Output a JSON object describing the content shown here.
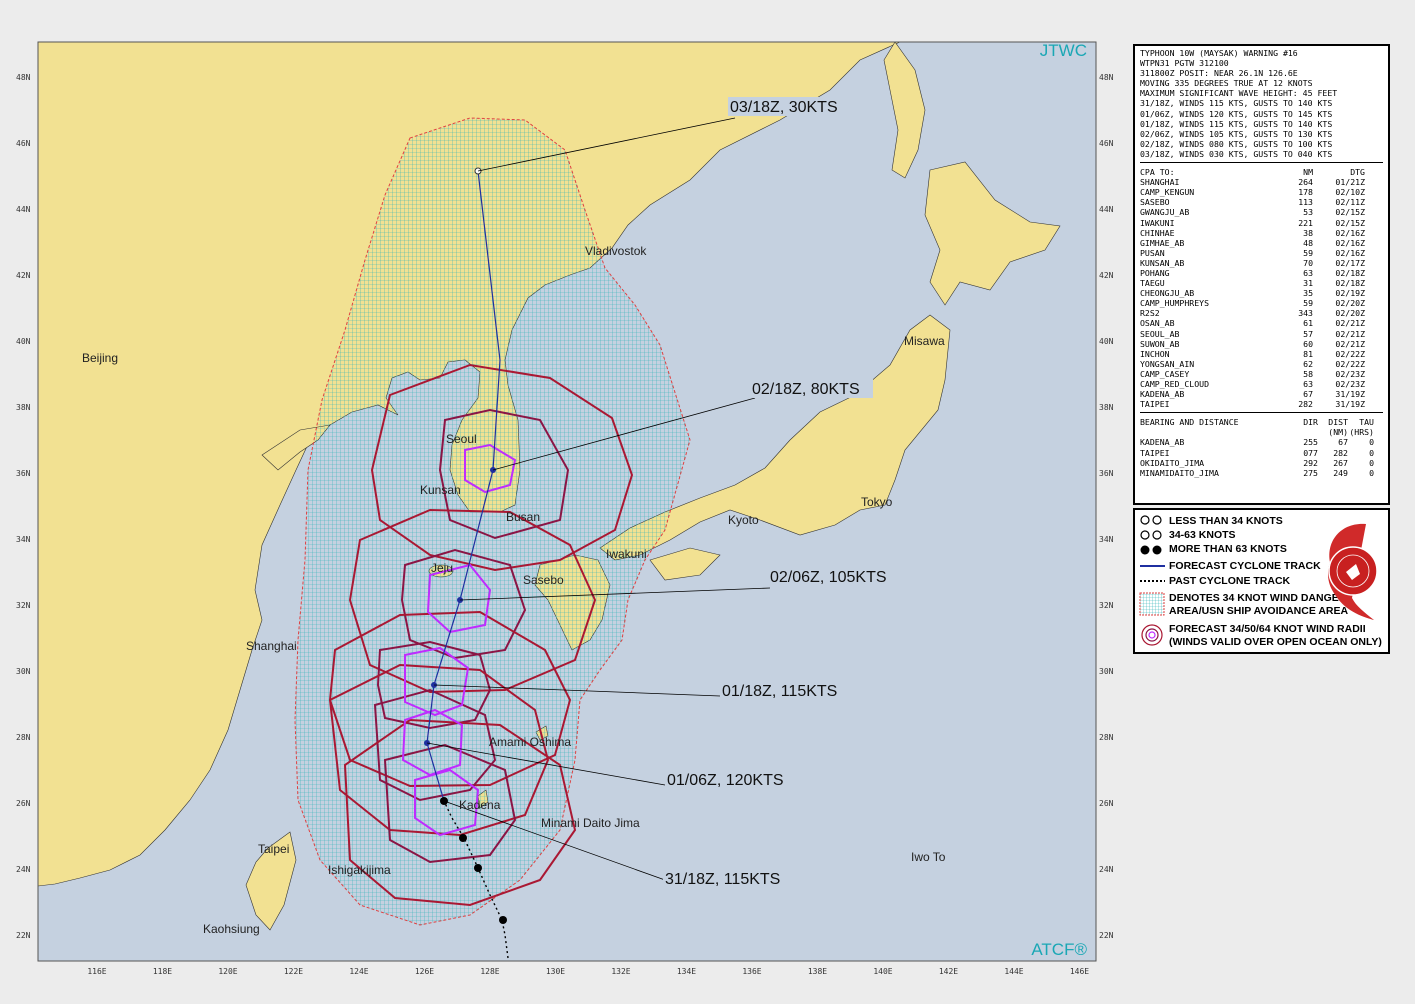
{
  "map": {
    "source_label": "JTWC",
    "footer_label": "ATCF®",
    "lon_labels": [
      "116E",
      "118E",
      "120E",
      "122E",
      "124E",
      "126E",
      "128E",
      "130E",
      "132E",
      "134E",
      "136E",
      "138E",
      "140E",
      "142E",
      "144E",
      "146E"
    ],
    "lat_labels": [
      "48N",
      "46N",
      "44N",
      "42N",
      "40N",
      "38N",
      "36N",
      "34N",
      "32N",
      "30N",
      "28N",
      "26N",
      "24N",
      "22N"
    ],
    "places": [
      "Vladivostok",
      "Beijing",
      "Misawa",
      "Seoul",
      "Kunsan",
      "Busan",
      "Kyoto",
      "Tokyo",
      "Iwakuni",
      "Jeju",
      "Sasebo",
      "Shanghai",
      "Amami Oshima",
      "Kadena",
      "Minami Daito Jima",
      "Taipei",
      "Iwo To",
      "Ishigakijima",
      "Kaohsiung"
    ],
    "forecast_labels": [
      "03/18Z,  30KTS",
      "02/18Z,  80KTS",
      "02/06Z, 105KTS",
      "01/18Z, 115KTS",
      "01/06Z, 120KTS",
      "31/18Z, 115KTS"
    ],
    "colors": {
      "land": "#f2e192",
      "ocean": "#c5d1e0",
      "danger": "#2fb3b8",
      "r34": "#aa1833",
      "r50": "#8b1545",
      "r64": "#bf2cff",
      "track": "#1f2fa0",
      "jtwc": "#1aa7b5"
    }
  },
  "warning": {
    "header": [
      "TYPHOON 10W (MAYSAK) WARNING #16",
      "WTPN31 PGTW 312100",
      "311800Z POSIT: NEAR 26.1N 126.6E",
      "MOVING 335 DEGREES TRUE AT 12 KNOTS",
      "MAXIMUM SIGNIFICANT WAVE HEIGHT: 45 FEET",
      "31/18Z, WINDS 115 KTS, GUSTS TO 140 KTS",
      "01/06Z, WINDS 120 KTS, GUSTS TO 145 KTS",
      "01/18Z, WINDS 115 KTS, GUSTS TO 140 KTS",
      "02/06Z, WINDS 105 KTS, GUSTS TO 130 KTS",
      "02/18Z, WINDS 080 KTS, GUSTS TO 100 KTS",
      "03/18Z, WINDS 030 KTS, GUSTS TO 040 KTS"
    ],
    "cpa_header": [
      "CPA TO:",
      "NM",
      "DTG"
    ],
    "cpa": [
      [
        "SHANGHAI",
        "264",
        "01/21Z"
      ],
      [
        "CAMP_KENGUN",
        "178",
        "02/10Z"
      ],
      [
        "SASEBO",
        "113",
        "02/11Z"
      ],
      [
        "GWANGJU_AB",
        "53",
        "02/15Z"
      ],
      [
        "IWAKUNI",
        "221",
        "02/15Z"
      ],
      [
        "CHINHAE",
        "38",
        "02/16Z"
      ],
      [
        "GIMHAE_AB",
        "48",
        "02/16Z"
      ],
      [
        "PUSAN",
        "59",
        "02/16Z"
      ],
      [
        "KUNSAN_AB",
        "70",
        "02/17Z"
      ],
      [
        "POHANG",
        "63",
        "02/18Z"
      ],
      [
        "TAEGU",
        "31",
        "02/18Z"
      ],
      [
        "CHEONGJU_AB",
        "35",
        "02/19Z"
      ],
      [
        "CAMP_HUMPHREYS",
        "59",
        "02/20Z"
      ],
      [
        "R2S2",
        "343",
        "02/20Z"
      ],
      [
        "OSAN_AB",
        "61",
        "02/21Z"
      ],
      [
        "SEOUL_AB",
        "57",
        "02/21Z"
      ],
      [
        "SUWON_AB",
        "60",
        "02/21Z"
      ],
      [
        "INCHON",
        "81",
        "02/22Z"
      ],
      [
        "YONGSAN_AIN",
        "62",
        "02/22Z"
      ],
      [
        "CAMP_CASEY",
        "58",
        "02/23Z"
      ],
      [
        "CAMP_RED_CLOUD",
        "63",
        "02/23Z"
      ],
      [
        "KADENA_AB",
        "67",
        "31/19Z"
      ],
      [
        "TAIPEI",
        "282",
        "31/19Z"
      ]
    ],
    "bearing_header": [
      "BEARING AND DISTANCE",
      "DIR",
      "DIST",
      "TAU"
    ],
    "bearing_sub": [
      "",
      "",
      "(NM)",
      "(HRS)"
    ],
    "bearing": [
      [
        "KADENA_AB",
        "255",
        "67",
        "0"
      ],
      [
        "TAIPEI",
        "077",
        "282",
        "0"
      ],
      [
        "OKIDAITO_JIMA",
        "292",
        "267",
        "0"
      ],
      [
        "MINAMIDAITO_JIMA",
        "275",
        "249",
        "0"
      ]
    ]
  },
  "legend": {
    "items": [
      "LESS THAN 34 KNOTS",
      "34-63 KNOTS",
      "MORE THAN 63 KNOTS",
      "FORECAST CYCLONE TRACK",
      "PAST CYCLONE TRACK",
      "DENOTES 34 KNOT WIND DANGER",
      "AREA/USN SHIP AVOIDANCE AREA",
      "FORECAST 34/50/64 KNOT WIND RADII",
      "(WINDS VALID OVER OPEN OCEAN ONLY)"
    ]
  }
}
